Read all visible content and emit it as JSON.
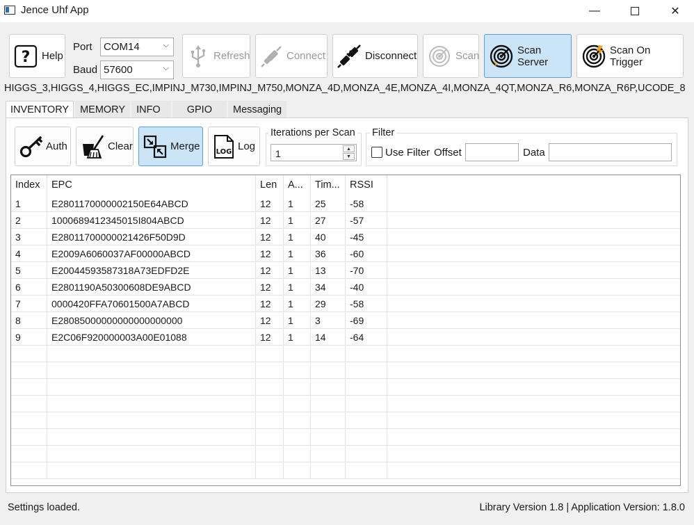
{
  "window": {
    "title": "Jence Uhf App",
    "minimize": "—",
    "close": "✕"
  },
  "toolbar": {
    "help": "Help",
    "port_label": "Port",
    "port_value": "COM14",
    "baud_label": "Baud",
    "baud_value": "57600",
    "refresh": "Refresh",
    "connect": "Connect",
    "disconnect": "Disconnect",
    "scan": "Scan",
    "scan_server": "Scan Server",
    "scan_on_trigger": "Scan On Trigger"
  },
  "protocols": "HIGGS_3,HIGGS_4,HIGGS_EC,IMPINJ_M730,IMPINJ_M750,MONZA_4D,MONZA_4E,MONZA_4I,MONZA_4QT,MONZA_R6,MONZA_R6P,UCODE_8",
  "tabs": [
    "INVENTORY",
    "MEMORY",
    "INFO",
    "GPIO",
    "Messaging"
  ],
  "inventory": {
    "auth": "Auth",
    "clear": "Clear",
    "merge": "Merge",
    "log": "Log",
    "log_icon_text": "LOG",
    "iterations_title": "Iterations per Scan",
    "iterations_value": "1",
    "filter_title": "Filter",
    "use_filter": "Use Filter",
    "offset_label": "Offset",
    "data_label": "Data"
  },
  "table": {
    "columns": [
      "Index",
      "EPC",
      "Len",
      "A...",
      "Tim...",
      "RSSI"
    ],
    "rows": [
      [
        "1",
        "E2801170000002150E64ABCD",
        "12",
        "1",
        "25",
        "-58"
      ],
      [
        "2",
        "1000689412345015I804ABCD",
        "12",
        "1",
        "27",
        "-57"
      ],
      [
        "3",
        "E28011700000021426F50D9D",
        "12",
        "1",
        "40",
        "-45"
      ],
      [
        "4",
        "E2009A6060037AF00000ABCD",
        "12",
        "1",
        "36",
        "-60"
      ],
      [
        "5",
        "E20044593587318A73EDFD2E",
        "12",
        "1",
        "13",
        "-70"
      ],
      [
        "6",
        "E2801190A50300608DE9ABCD",
        "12",
        "1",
        "34",
        "-40"
      ],
      [
        "7",
        "0000420FFA70601500A7ABCD",
        "12",
        "1",
        "29",
        "-58"
      ],
      [
        "8",
        "E28085000000000000000000",
        "12",
        "1",
        "3",
        "-69"
      ],
      [
        "9",
        "E2C06F920000003A00E01088",
        "12",
        "1",
        "14",
        "-64"
      ]
    ]
  },
  "status": {
    "left": "Settings loaded.",
    "right": "Library Version 1.8 | Application Version: 1.8.0"
  }
}
